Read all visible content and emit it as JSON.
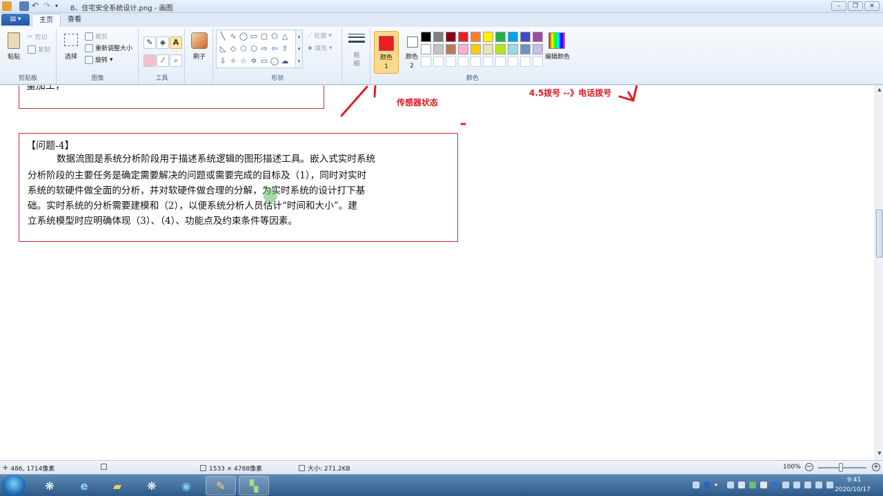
{
  "window": {
    "title": "8、住宅安全系统设计.png - 画图",
    "controls": [
      "minimize",
      "restore",
      "close"
    ]
  },
  "tabs": [
    {
      "label": "主页",
      "active": true
    },
    {
      "label": "查看",
      "active": false
    }
  ],
  "ribbon": {
    "clipboard": {
      "label": "剪贴板",
      "paste": "粘贴",
      "cut": "剪切",
      "copy": "复制"
    },
    "image": {
      "label": "图像",
      "select": "选择",
      "crop": "裁剪",
      "resize": "重新调整大小",
      "rotate": "旋转"
    },
    "tools": {
      "label": "工具"
    },
    "brushes": {
      "label": "刷子"
    },
    "shapes": {
      "label": "形状",
      "outline": "轮廓",
      "fill": "填充"
    },
    "size": {
      "label": "粗细"
    },
    "colors": {
      "label": "颜色",
      "color1": "颜色 1",
      "color2": "颜色 2",
      "edit": "编辑颜色",
      "color1_value": "#ed1c24",
      "color2_value": "#ffffff",
      "palette_row1": [
        "#000000",
        "#7f7f7f",
        "#880015",
        "#ed1c24",
        "#ff7f27",
        "#fff200",
        "#22b14c",
        "#00a2e8",
        "#3f48cc",
        "#a349a4"
      ],
      "palette_row2": [
        "#ffffff",
        "#c3c3c3",
        "#b97a57",
        "#ffaec9",
        "#ffc90e",
        "#efe4b0",
        "#b5e61d",
        "#99d9ea",
        "#7092be",
        "#c8bfe7"
      ],
      "palette_row3": [
        "#ffffff",
        "#ffffff",
        "#ffffff",
        "#ffffff",
        "#ffffff",
        "#ffffff",
        "#ffffff",
        "#ffffff",
        "#ffffff",
        "#ffffff"
      ]
    }
  },
  "canvas": {
    "fragment_text": "重加工，",
    "annotations": {
      "sensor_state": "传感器状态",
      "dial": "4.5拨号 --》电话拨号"
    },
    "question": {
      "title": "【问题-4】",
      "lines": [
        "数据流图是系统分析阶段用于描述系统逻辑的图形描述工具。嵌入式实时系统",
        "分析阶段的主要任务是确定需要解决的问题或需要完成的目标及（1），同时对实时",
        "系统的软硬件做全面的分析，并对软硬件做合理的分解，为实时系统的设计打下基",
        "础。实时系统的分析需要建模和（2），以便系统分析人员估计“时间和大小”。建",
        "立系统模型时应明确体现（3）、（4）、功能点及约束条件等因素。"
      ]
    }
  },
  "status": {
    "cursor": "486, 1714像素",
    "dimensions": "1533 × 4788像素",
    "filesize": "大小: 271.2KB",
    "zoom": "100%",
    "zoom_level": 1.0
  },
  "taskbar": {
    "time": "9:41",
    "date": "2020/10/17"
  }
}
